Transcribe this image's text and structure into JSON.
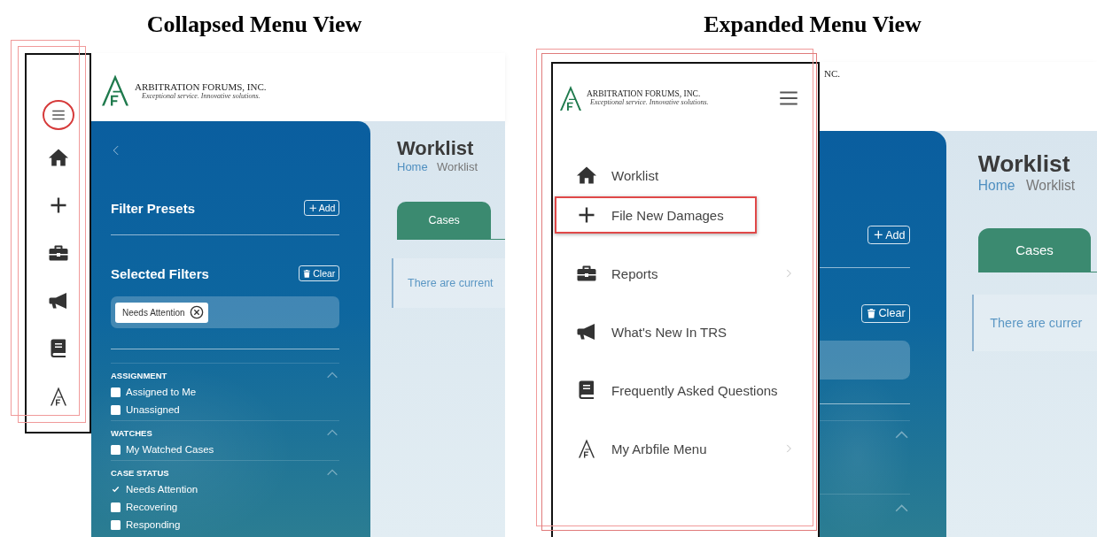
{
  "figures": [
    {
      "caption": "Collapsed Menu View",
      "kind": "collapsed",
      "nav": {
        "menu_button": {
          "annotated": true
        },
        "items": [
          {
            "kind": "home"
          },
          {
            "kind": "plus"
          },
          {
            "kind": "briefcase"
          },
          {
            "kind": "megaphone"
          },
          {
            "kind": "book"
          },
          {
            "kind": "logo"
          }
        ]
      },
      "app": {
        "header": {
          "kind": "full",
          "logo_title": "ARBITRATION FORUMS, INC.",
          "logo_tagline": "Exceptional service. Innovative solutions."
        },
        "filter_panel": {
          "kind": "full",
          "presets": {
            "title": "Filter Presets",
            "button": "Add"
          },
          "selected": {
            "title": "Selected Filters",
            "button": "Clear",
            "chips": [
              "Needs Attention"
            ]
          },
          "sections": [
            {
              "title": "ASSIGNMENT",
              "expanded": true,
              "options": [
                {
                  "label": "Assigned to Me",
                  "checked": false
                },
                {
                  "label": "Unassigned",
                  "checked": false
                }
              ]
            },
            {
              "title": "WATCHES",
              "expanded": true,
              "options": [
                {
                  "label": "My Watched Cases",
                  "checked": false
                }
              ]
            },
            {
              "title": "CASE STATUS",
              "expanded": true,
              "options": [
                {
                  "label": "Needs Attention",
                  "checked": true
                },
                {
                  "label": "Recovering",
                  "checked": false
                },
                {
                  "label": "Responding",
                  "checked": false
                }
              ]
            }
          ]
        },
        "main": {
          "title": "Worklist",
          "breadcrumb": [
            "Home",
            "Worklist"
          ],
          "tabs": [
            {
              "label": "Cases",
              "selected": true
            }
          ],
          "message": "There are current"
        }
      }
    },
    {
      "caption": "Expanded Menu View",
      "kind": "expanded",
      "menu": {
        "logo_title": "ARBITRATION FORUMS, INC.",
        "logo_tagline": "Exceptional service. Innovative solutions.",
        "items": [
          {
            "kind": "home",
            "label": "Worklist",
            "submenu": false,
            "annotated": false
          },
          {
            "kind": "plus",
            "label": "File New Damages",
            "submenu": false,
            "annotated": true
          },
          {
            "kind": "briefcase",
            "label": "Reports",
            "submenu": true,
            "annotated": false
          },
          {
            "kind": "megaphone",
            "label": "What's New In TRS",
            "submenu": false,
            "annotated": false
          },
          {
            "kind": "book",
            "label": "Frequently Asked Questions",
            "submenu": false,
            "annotated": false
          },
          {
            "kind": "logo",
            "label": "My Arbfile Menu",
            "submenu": true,
            "annotated": false
          }
        ]
      },
      "app": {
        "header": {
          "kind": "clipped",
          "logo_title": "NC."
        },
        "filter_panel": {
          "kind": "partial",
          "presets": {
            "button": "Add"
          },
          "selected": {
            "button": "Clear"
          },
          "sections": [
            {
              "expanded": true
            },
            {
              "expanded": true
            }
          ]
        },
        "main": {
          "title": "Worklist",
          "breadcrumb": [
            "Home",
            "Worklist"
          ],
          "tabs": [
            {
              "label": "Cases",
              "selected": true
            }
          ],
          "message": "There are currer"
        }
      }
    }
  ]
}
